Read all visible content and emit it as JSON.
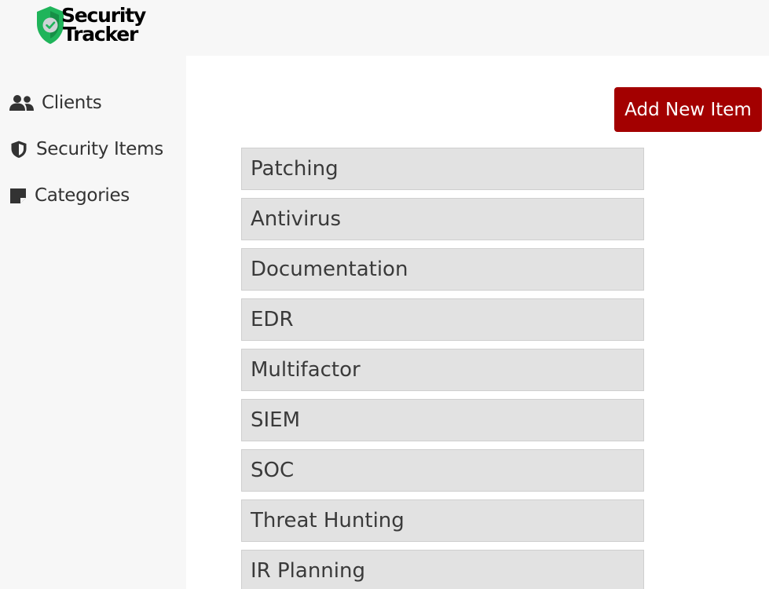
{
  "brand": {
    "line1": "Security",
    "line2": "Tracker",
    "icon": "shield-check-icon",
    "shield_color": "#1fb45a"
  },
  "sidebar": {
    "items": [
      {
        "label": "Clients",
        "icon": "users-icon"
      },
      {
        "label": "Security Items",
        "icon": "shield-icon"
      },
      {
        "label": "Categories",
        "icon": "note-icon"
      }
    ]
  },
  "main": {
    "add_button_label": "Add New Item",
    "items": [
      "Patching",
      "Antivirus",
      "Documentation",
      "EDR",
      "Multifactor",
      "SIEM",
      "SOC",
      "Threat Hunting",
      "IR Planning"
    ]
  },
  "colors": {
    "accent": "#a30000",
    "sidebar_bg": "#f7f7f7",
    "content_bg": "#ffffff",
    "item_bg": "#e2e2e2"
  }
}
